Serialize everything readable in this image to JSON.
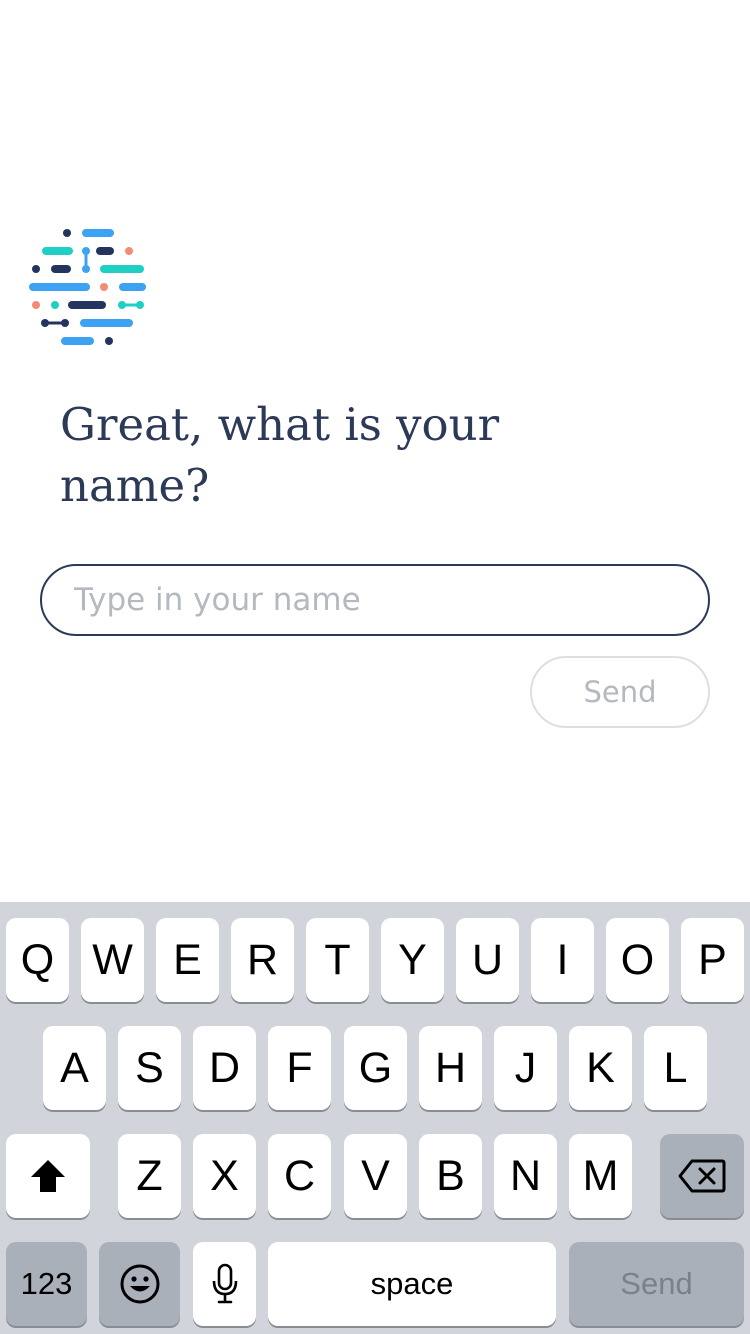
{
  "prompt": {
    "question_line1": "Great, what is your",
    "question_line2": "name?"
  },
  "name_field": {
    "value": "",
    "placeholder": "Type in your name"
  },
  "send_button": {
    "label": "Send"
  },
  "colors": {
    "text_navy": "#2c3a57",
    "logo_navy": "#23345f",
    "logo_blue": "#3ea2f2",
    "logo_teal": "#1fcfc4",
    "logo_coral": "#f28c74",
    "keyboard_bg": "#d1d5db"
  },
  "keyboard": {
    "row1": [
      "Q",
      "W",
      "E",
      "R",
      "T",
      "Y",
      "U",
      "I",
      "O",
      "P"
    ],
    "row2": [
      "A",
      "S",
      "D",
      "F",
      "G",
      "H",
      "J",
      "K",
      "L"
    ],
    "row3": [
      "Z",
      "X",
      "C",
      "V",
      "B",
      "N",
      "M"
    ],
    "shift_icon": "shift-icon",
    "delete_icon": "delete-icon",
    "numbers_label": "123",
    "emoji_icon": "emoji-icon",
    "mic_icon": "microphone-icon",
    "space_label": "space",
    "return_label": "Send"
  }
}
